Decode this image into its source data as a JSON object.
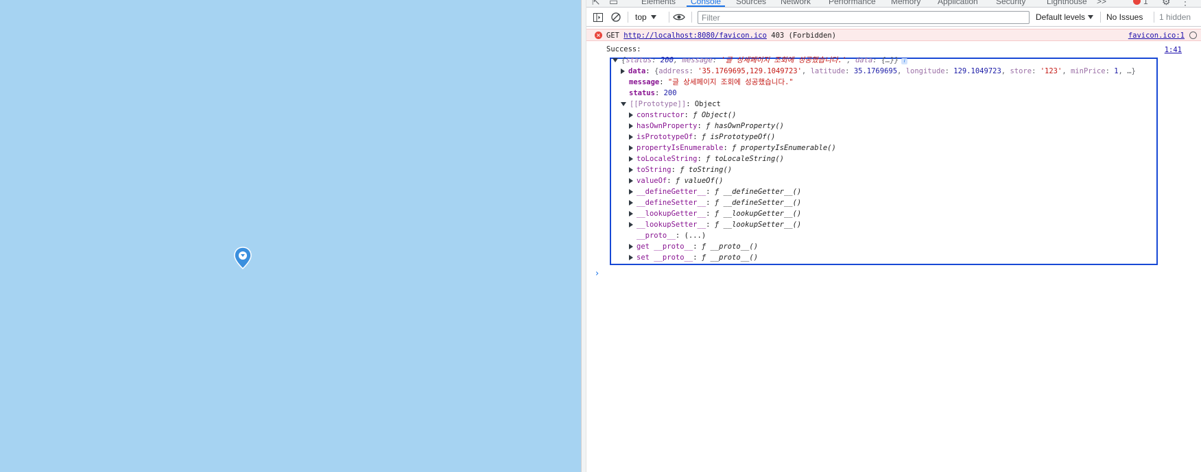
{
  "tabs": {
    "items": [
      "Elements",
      "Console",
      "Sources",
      "Network",
      "Performance",
      "Memory",
      "Application",
      "Security",
      "Lighthouse"
    ],
    "more": ">>",
    "error_count": "1"
  },
  "toolbar": {
    "context": "top",
    "filter_placeholder": "Filter",
    "levels": "Default levels",
    "issues": "No Issues",
    "hidden": "1 hidden"
  },
  "error_entry": {
    "method": "GET",
    "url": "http://localhost:8080/favicon.ico",
    "status": "403 (Forbidden)",
    "source": "favicon.ico:1"
  },
  "log": {
    "label": "Success:",
    "source": "1:41",
    "summary": {
      "open": "{",
      "status_key": "status",
      "status_val": "200",
      "message_key": "message",
      "message_val": "'글 상세페이지 조회에 성공했습니다.'",
      "data_key": "data",
      "data_val": "{…}",
      "close": "}"
    },
    "data_line": {
      "key": "data",
      "open": "{",
      "address_key": "address",
      "address_val": "'35.1769695,129.1049723'",
      "lat_key": "latitude",
      "lat_val": "35.1769695",
      "lng_key": "longitude",
      "lng_val": "129.1049723",
      "store_key": "store",
      "store_val": "'123'",
      "minprice_key": "minPrice",
      "minprice_val": "1",
      "tail": "…}"
    },
    "message_line": {
      "key": "message",
      "val": "\"글 상세페이지 조회에 성공했습니다.\""
    },
    "status_line": {
      "key": "status",
      "val": "200"
    },
    "prototype_line": {
      "key": "[[Prototype]]",
      "val": "Object"
    },
    "proto_members": [
      {
        "key": "constructor",
        "fn": "Object()"
      },
      {
        "key": "hasOwnProperty",
        "fn": "hasOwnProperty()"
      },
      {
        "key": "isPrototypeOf",
        "fn": "isPrototypeOf()"
      },
      {
        "key": "propertyIsEnumerable",
        "fn": "propertyIsEnumerable()"
      },
      {
        "key": "toLocaleString",
        "fn": "toLocaleString()"
      },
      {
        "key": "toString",
        "fn": "toString()"
      },
      {
        "key": "valueOf",
        "fn": "valueOf()"
      },
      {
        "key": "__defineGetter__",
        "fn": "__defineGetter__()"
      },
      {
        "key": "__defineSetter__",
        "fn": "__defineSetter__()"
      },
      {
        "key": "__lookupGetter__",
        "fn": "__lookupGetter__()"
      },
      {
        "key": "__lookupSetter__",
        "fn": "__lookupSetter__()"
      }
    ],
    "proto_accessor": {
      "key": "__proto__",
      "val": "(...)"
    },
    "proto_get": {
      "key": "get __proto__",
      "fn": "__proto__()"
    },
    "proto_set": {
      "key": "set __proto__",
      "fn": "__proto__()"
    },
    "fn_glyph": "ƒ"
  },
  "prompt": "›",
  "colors": {
    "map": "#a6d3f2",
    "pin": "#3a8fde",
    "highlight": "#1748d5",
    "error_bg": "#fcebeb"
  }
}
